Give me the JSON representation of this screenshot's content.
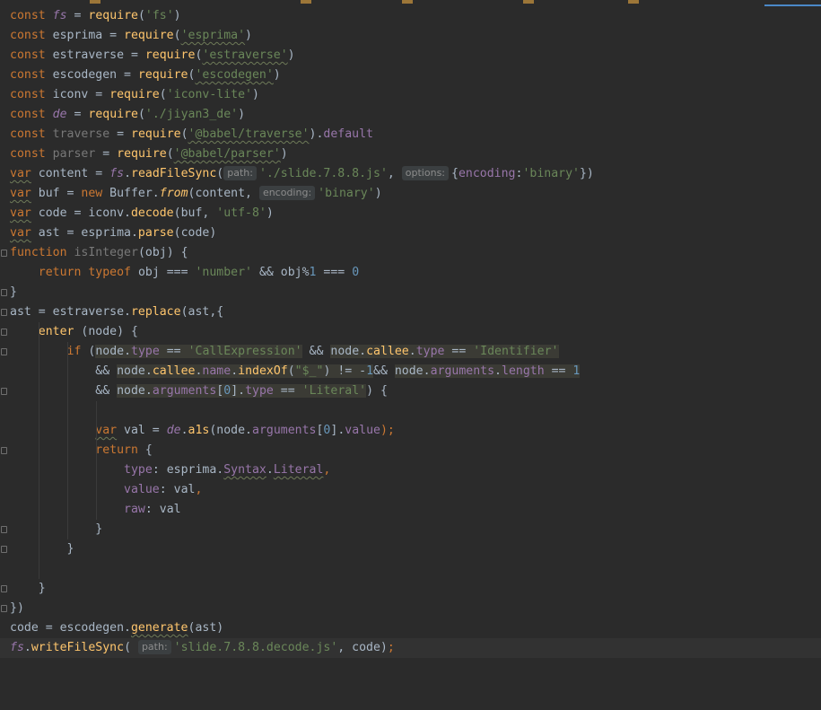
{
  "lines": [
    [
      {
        "t": "const",
        "c": "kw"
      },
      {
        "t": " "
      },
      {
        "t": "fs",
        "c": "gl"
      },
      {
        "t": " = "
      },
      {
        "t": "require",
        "c": "fn"
      },
      {
        "t": "("
      },
      {
        "t": "'fs'",
        "c": "str"
      },
      {
        "t": ")"
      }
    ],
    [
      {
        "t": "const",
        "c": "kw"
      },
      {
        "t": " esprima = "
      },
      {
        "t": "require",
        "c": "fn"
      },
      {
        "t": "("
      },
      {
        "t": "'esprima'",
        "c": "str wavy"
      },
      {
        "t": ")"
      }
    ],
    [
      {
        "t": "const",
        "c": "kw"
      },
      {
        "t": " estraverse = "
      },
      {
        "t": "require",
        "c": "fn"
      },
      {
        "t": "("
      },
      {
        "t": "'estraverse'",
        "c": "str wavy"
      },
      {
        "t": ")"
      }
    ],
    [
      {
        "t": "const",
        "c": "kw"
      },
      {
        "t": " escodegen = "
      },
      {
        "t": "require",
        "c": "fn"
      },
      {
        "t": "("
      },
      {
        "t": "'escodegen'",
        "c": "str wavy"
      },
      {
        "t": ")"
      }
    ],
    [
      {
        "t": "const",
        "c": "kw"
      },
      {
        "t": " iconv = "
      },
      {
        "t": "require",
        "c": "fn"
      },
      {
        "t": "("
      },
      {
        "t": "'iconv-lite'",
        "c": "str"
      },
      {
        "t": ")"
      }
    ],
    [
      {
        "t": "const",
        "c": "kw"
      },
      {
        "t": " "
      },
      {
        "t": "de",
        "c": "gl"
      },
      {
        "t": " = "
      },
      {
        "t": "require",
        "c": "fn"
      },
      {
        "t": "("
      },
      {
        "t": "'./jiyan3_de'",
        "c": "str"
      },
      {
        "t": ")"
      }
    ],
    [
      {
        "t": "const",
        "c": "kw"
      },
      {
        "t": " "
      },
      {
        "t": "traverse",
        "c": "dim"
      },
      {
        "t": " = "
      },
      {
        "t": "require",
        "c": "fn"
      },
      {
        "t": "("
      },
      {
        "t": "'@babel/traverse'",
        "c": "str wavy"
      },
      {
        "t": ")."
      },
      {
        "t": "default",
        "c": "prop"
      }
    ],
    [
      {
        "t": "const",
        "c": "kw"
      },
      {
        "t": " "
      },
      {
        "t": "parser",
        "c": "dim"
      },
      {
        "t": " = "
      },
      {
        "t": "require",
        "c": "fn"
      },
      {
        "t": "("
      },
      {
        "t": "'@babel/parser'",
        "c": "str wavy"
      },
      {
        "t": ")"
      }
    ],
    [
      {
        "t": "var",
        "c": "kw wavy"
      },
      {
        "t": " content = "
      },
      {
        "t": "fs",
        "c": "gl"
      },
      {
        "t": "."
      },
      {
        "t": "readFileSync",
        "c": "fn"
      },
      {
        "t": "("
      },
      {
        "t": "path:",
        "c": "hint"
      },
      {
        "t": "'./slide.7.8.8.js'",
        "c": "str"
      },
      {
        "t": ", "
      },
      {
        "t": "options:",
        "c": "hint"
      },
      {
        "t": "{"
      },
      {
        "t": "encoding",
        "c": "prop"
      },
      {
        "t": ":"
      },
      {
        "t": "'binary'",
        "c": "str"
      },
      {
        "t": "})"
      }
    ],
    [
      {
        "t": "var",
        "c": "kw wavy"
      },
      {
        "t": " buf = "
      },
      {
        "t": "new",
        "c": "kw"
      },
      {
        "t": " Buffer."
      },
      {
        "t": "from",
        "c": "static"
      },
      {
        "t": "(content, "
      },
      {
        "t": "encoding:",
        "c": "hint"
      },
      {
        "t": "'binary'",
        "c": "str"
      },
      {
        "t": ")"
      }
    ],
    [
      {
        "t": "var",
        "c": "kw wavy"
      },
      {
        "t": " code = iconv."
      },
      {
        "t": "decode",
        "c": "fn"
      },
      {
        "t": "(buf, "
      },
      {
        "t": "'utf-8'",
        "c": "str"
      },
      {
        "t": ")"
      }
    ],
    [
      {
        "t": "var",
        "c": "kw wavy"
      },
      {
        "t": " ast = esprima."
      },
      {
        "t": "parse",
        "c": "fn"
      },
      {
        "t": "(code)"
      }
    ],
    [
      {
        "t": "function",
        "c": "kw"
      },
      {
        "t": " "
      },
      {
        "t": "isInteger",
        "c": "dim"
      },
      {
        "t": "(obj) {"
      }
    ],
    [
      {
        "t": "    "
      },
      {
        "t": "return",
        "c": "kw"
      },
      {
        "t": " "
      },
      {
        "t": "typeof",
        "c": "kw"
      },
      {
        "t": " obj === "
      },
      {
        "t": "'number'",
        "c": "str"
      },
      {
        "t": " && obj%"
      },
      {
        "t": "1",
        "c": "num"
      },
      {
        "t": " === "
      },
      {
        "t": "0",
        "c": "num"
      }
    ],
    [
      {
        "t": "}"
      }
    ],
    [
      {
        "t": "ast = estraverse."
      },
      {
        "t": "replace",
        "c": "fn"
      },
      {
        "t": "(ast,{"
      }
    ],
    [
      {
        "t": "    "
      },
      {
        "t": "enter",
        "c": "fn"
      },
      {
        "t": " (node) {"
      }
    ],
    [
      {
        "t": "        "
      },
      {
        "t": "if",
        "c": "kw"
      },
      {
        "t": " ("
      },
      {
        "t": "node",
        "c": "hl"
      },
      {
        "t": ".",
        "c": "hl"
      },
      {
        "t": "type",
        "c": "prop hl"
      },
      {
        "t": " == ",
        "c": "hl"
      },
      {
        "t": "'CallExpression'",
        "c": "str hl"
      },
      {
        "t": " && "
      },
      {
        "t": "node",
        "c": "hl"
      },
      {
        "t": ".",
        "c": "hl"
      },
      {
        "t": "callee",
        "c": "fn hl"
      },
      {
        "t": ".",
        "c": "hl"
      },
      {
        "t": "type",
        "c": "prop hl"
      },
      {
        "t": " == ",
        "c": "hl"
      },
      {
        "t": "'Identifier'",
        "c": "str hl"
      }
    ],
    [
      {
        "t": "            "
      },
      {
        "t": "&& "
      },
      {
        "t": "node",
        "c": "hl"
      },
      {
        "t": ".",
        "c": "hl"
      },
      {
        "t": "callee",
        "c": "fn hl"
      },
      {
        "t": ".",
        "c": "hl"
      },
      {
        "t": "name",
        "c": "prop hl"
      },
      {
        "t": ".",
        "c": "hl"
      },
      {
        "t": "indexOf",
        "c": "fn hl"
      },
      {
        "t": "(",
        "c": "hl"
      },
      {
        "t": "\"$_\"",
        "c": "str hl"
      },
      {
        "t": ") != -",
        "c": "hl"
      },
      {
        "t": "1",
        "c": "num hl"
      },
      {
        "t": "&& "
      },
      {
        "t": "node",
        "c": "hl"
      },
      {
        "t": ".",
        "c": "hl"
      },
      {
        "t": "arguments",
        "c": "prop hl"
      },
      {
        "t": ".",
        "c": "hl"
      },
      {
        "t": "length",
        "c": "prop hl"
      },
      {
        "t": " == ",
        "c": "hl"
      },
      {
        "t": "1",
        "c": "num hl"
      }
    ],
    [
      {
        "t": "            "
      },
      {
        "t": "&& "
      },
      {
        "t": "node",
        "c": "hl"
      },
      {
        "t": ".",
        "c": "hl"
      },
      {
        "t": "arguments",
        "c": "prop hl"
      },
      {
        "t": "[",
        "c": "hl"
      },
      {
        "t": "0",
        "c": "num hl"
      },
      {
        "t": "].",
        "c": "hl"
      },
      {
        "t": "type",
        "c": "prop hl"
      },
      {
        "t": " == ",
        "c": "hl"
      },
      {
        "t": "'Literal'",
        "c": "str hl"
      },
      {
        "t": ") {"
      }
    ],
    [
      {
        "t": ""
      }
    ],
    [
      {
        "t": "            "
      },
      {
        "t": "var",
        "c": "kw wavy"
      },
      {
        "t": " val = "
      },
      {
        "t": "de",
        "c": "gl"
      },
      {
        "t": "."
      },
      {
        "t": "a1s",
        "c": "fn"
      },
      {
        "t": "(node."
      },
      {
        "t": "arguments",
        "c": "prop"
      },
      {
        "t": "["
      },
      {
        "t": "0",
        "c": "num"
      },
      {
        "t": "]."
      },
      {
        "t": "value",
        "c": "prop"
      },
      {
        "t": ");",
        "c": "kw"
      }
    ],
    [
      {
        "t": "            "
      },
      {
        "t": "return",
        "c": "kw"
      },
      {
        "t": " {"
      }
    ],
    [
      {
        "t": "                "
      },
      {
        "t": "type",
        "c": "prop"
      },
      {
        "t": ": esprima."
      },
      {
        "t": "Syntax",
        "c": "prop wavy"
      },
      {
        "t": "."
      },
      {
        "t": "Literal",
        "c": "prop wavy"
      },
      {
        "t": ",",
        "c": "kw"
      }
    ],
    [
      {
        "t": "                "
      },
      {
        "t": "value",
        "c": "prop"
      },
      {
        "t": ": val"
      },
      {
        "t": ",",
        "c": "kw"
      }
    ],
    [
      {
        "t": "                "
      },
      {
        "t": "raw",
        "c": "prop"
      },
      {
        "t": ": val"
      }
    ],
    [
      {
        "t": "            }"
      }
    ],
    [
      {
        "t": "        }"
      }
    ],
    [
      {
        "t": ""
      }
    ],
    [
      {
        "t": "    }"
      }
    ],
    [
      {
        "t": "})"
      }
    ],
    [
      {
        "t": "code = escodegen."
      },
      {
        "t": "generate",
        "c": "fn wavy"
      },
      {
        "t": "(ast)"
      }
    ],
    [
      {
        "t": "fs",
        "c": "gl"
      },
      {
        "t": "."
      },
      {
        "t": "writeFileSync",
        "c": "fn"
      },
      {
        "t": "( "
      },
      {
        "t": "path:",
        "c": "hint"
      },
      {
        "t": "'slide.7.8.8.decode.js'",
        "c": "str"
      },
      {
        "t": ", code)"
      },
      {
        "t": ";",
        "c": "kw"
      }
    ]
  ]
}
